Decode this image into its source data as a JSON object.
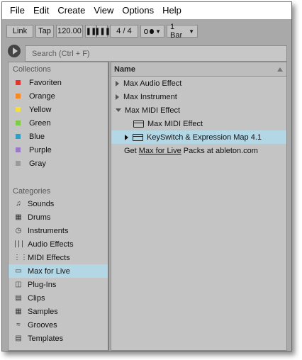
{
  "menubar": {
    "items": [
      "File",
      "Edit",
      "Create",
      "View",
      "Options",
      "Help"
    ]
  },
  "transport": {
    "link_label": "Link",
    "tap_label": "Tap",
    "tempo": "120.00",
    "time_signature": "4 / 4",
    "quantize": "1 Bar"
  },
  "search": {
    "placeholder": "Search (Ctrl + F)"
  },
  "collections": {
    "title": "Collections",
    "items": [
      {
        "label": "Favoriten",
        "color": "#e8322c"
      },
      {
        "label": "Orange",
        "color": "#f28c28"
      },
      {
        "label": "Yellow",
        "color": "#f3e13a"
      },
      {
        "label": "Green",
        "color": "#7fcc4a"
      },
      {
        "label": "Blue",
        "color": "#2e9fc7"
      },
      {
        "label": "Purple",
        "color": "#9a7ac4"
      },
      {
        "label": "Gray",
        "color": "#9a9a9a"
      }
    ]
  },
  "categories": {
    "title": "Categories",
    "items": [
      {
        "label": "Sounds",
        "icon": "sounds-icon"
      },
      {
        "label": "Drums",
        "icon": "drums-icon"
      },
      {
        "label": "Instruments",
        "icon": "instruments-icon"
      },
      {
        "label": "Audio Effects",
        "icon": "audio-effects-icon"
      },
      {
        "label": "MIDI Effects",
        "icon": "midi-effects-icon"
      },
      {
        "label": "Max for Live",
        "icon": "max-for-live-icon",
        "selected": true
      },
      {
        "label": "Plug-Ins",
        "icon": "plug-ins-icon"
      },
      {
        "label": "Clips",
        "icon": "clips-icon"
      },
      {
        "label": "Samples",
        "icon": "samples-icon"
      },
      {
        "label": "Grooves",
        "icon": "grooves-icon"
      },
      {
        "label": "Templates",
        "icon": "templates-icon"
      }
    ]
  },
  "content": {
    "column_header": "Name",
    "rows": [
      {
        "label": "Max Audio Effect",
        "expander": "collapsed"
      },
      {
        "label": "Max Instrument",
        "expander": "collapsed"
      },
      {
        "label": "Max MIDI Effect",
        "expander": "expanded"
      },
      {
        "label": "Max MIDI Effect",
        "icon": "device-icon"
      },
      {
        "label": "KeySwitch & Expression Map 4.1",
        "icon": "device-icon",
        "expander": "collapsed",
        "selected": true
      }
    ],
    "footer": {
      "prefix": "Get ",
      "link": "Max for Live",
      "suffix": " Packs at ableton.com"
    }
  },
  "colors": {
    "selection": "#b4d7e6",
    "panel": "#c4c4c4",
    "frame": "#a9a9a9"
  }
}
